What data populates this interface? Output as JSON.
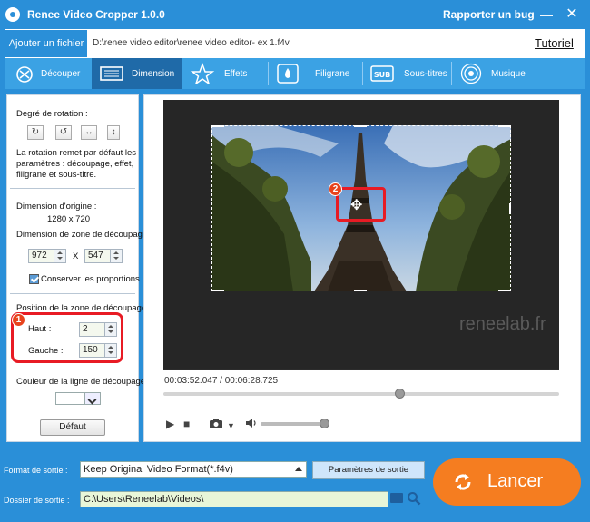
{
  "titlebar": {
    "title": "Renee Video Cropper 1.0.0",
    "bug_link": "Rapporter un bug",
    "minimize": "—",
    "close": "✕"
  },
  "filebar": {
    "add_file": "Ajouter un fichier",
    "path": "D:\\renee video editor\\renee video editor- ex 1.f4v",
    "tutorial": "Tutoriel"
  },
  "tabs": [
    {
      "label": "Découper",
      "icon": "cut-icon"
    },
    {
      "label": "Dimension",
      "icon": "dimension-icon",
      "active": true
    },
    {
      "label": "Effets",
      "icon": "effects-icon"
    },
    {
      "label": "Filigrane",
      "icon": "watermark-icon"
    },
    {
      "label": "Sous-titres",
      "icon": "subtitle-icon"
    },
    {
      "label": "Musique",
      "icon": "music-icon"
    }
  ],
  "left_panel": {
    "rotation_label": "Degré de rotation :",
    "rotation_note": [
      "La rotation remet par défaut les",
      "paramètres : découpage, effet,",
      "filigrane et sous-titre."
    ],
    "origin_label": "Dimension d'origine :",
    "origin_value": "1280 x 720",
    "crop_size_label": "Dimension de zone de découpage",
    "width": "972",
    "times": "X",
    "height": "547",
    "keep_ratio": "Conserver les proportions",
    "position_label": "Position de la zone de découpage",
    "top_label": "Haut :",
    "top_value": "2",
    "left_label": "Gauche :",
    "left_value": "150",
    "line_color_label": "Couleur de la ligne de découpage",
    "default_btn": "Défaut",
    "badge1": "1"
  },
  "preview": {
    "watermark": "reneelab.fr",
    "time": "00:03:52.047 / 00:06:28.725",
    "badge2": "2"
  },
  "bottom": {
    "format_label": "Format de sortie :",
    "format_value": "Keep Original Video Format(*.f4v)",
    "settings_btn": "Paramètres de sortie",
    "folder_label": "Dossier de sortie :",
    "folder_value": "C:\\Users\\Reneelab\\Videos\\",
    "launch": "Lancer"
  },
  "colors": {
    "brand_blue": "#2a8fd8",
    "active_tab": "#1f6aa8",
    "launch_orange": "#f57d20",
    "highlight_red": "#e81b24"
  }
}
